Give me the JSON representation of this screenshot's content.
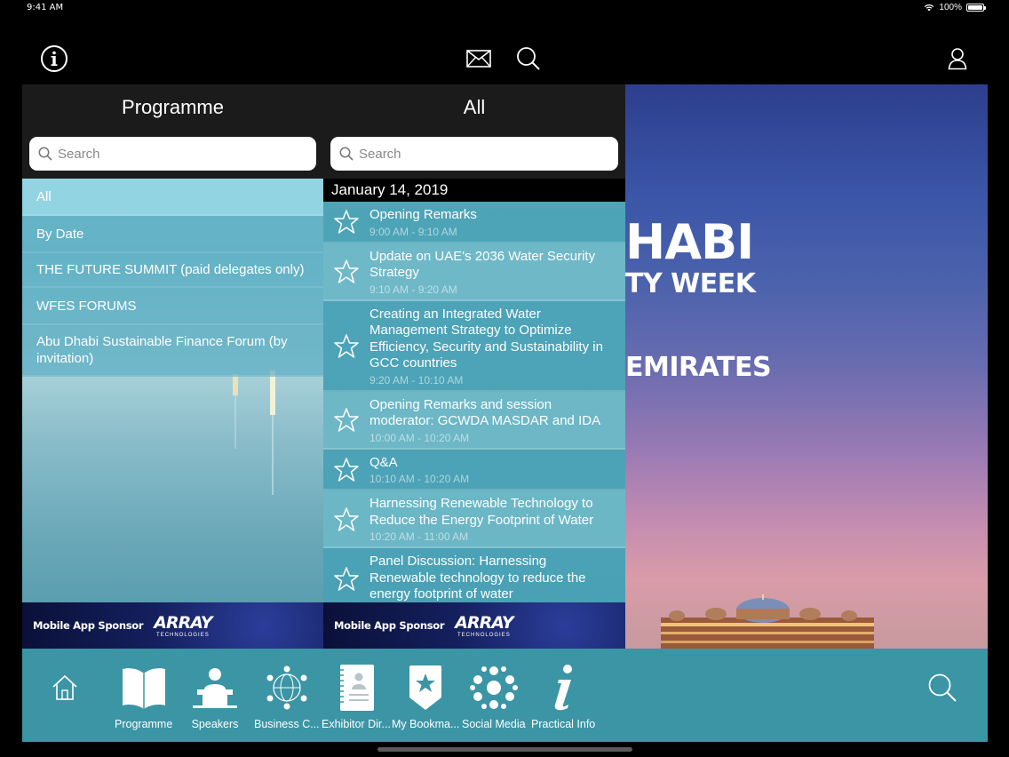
{
  "status_bar": {
    "time": "9:41 AM",
    "battery": "100%"
  },
  "top_bar": {
    "icons": [
      "info-icon",
      "mail-icon",
      "search-icon",
      "user-icon"
    ]
  },
  "programme_panel": {
    "title": "Programme",
    "search_placeholder": "Search",
    "items": [
      {
        "label": "All",
        "active": true
      },
      {
        "label": "By Date"
      },
      {
        "label": "THE FUTURE SUMMIT (paid delegates only)"
      },
      {
        "label": "WFES FORUMS"
      },
      {
        "label": "Abu Dhabi Sustainable Finance Forum (by invitation)"
      }
    ]
  },
  "sessions_panel": {
    "title": "All",
    "search_placeholder": "Search",
    "date": "January 14, 2019",
    "sessions": [
      {
        "title": "Opening Remarks",
        "time": "9:00 AM - 9:10 AM"
      },
      {
        "title": "Update on UAE's 2036 Water Security Strategy",
        "time": "9:10 AM - 9:20 AM"
      },
      {
        "title": "Creating an Integrated Water Management Strategy to Optimize Efficiency, Security and Sustainability in GCC countries",
        "time": "9:20 AM - 10:10 AM"
      },
      {
        "title": "Opening Remarks and session moderator: GCWDA MASDAR and IDA",
        "time": "10:00 AM - 10:20 AM"
      },
      {
        "title": "Q&A",
        "time": "10:10 AM - 10:20 AM"
      },
      {
        "title": "Harnessing Renewable Technology to Reduce the Energy Footprint of Water",
        "time": "10:20 AM - 11:00 AM"
      },
      {
        "title": "Panel Discussion: Harnessing Renewable technology to reduce the energy footprint of water",
        "time": ""
      }
    ]
  },
  "sponsor": {
    "label": "Mobile App Sponsor",
    "logo_name": "ARRAY",
    "logo_sub": "TECHNOLOGIES"
  },
  "hero": {
    "line1": "HABI",
    "line2": "TY WEEK",
    "line3": "EMIRATES"
  },
  "tab_bar": {
    "tabs": [
      {
        "label": "",
        "icon": "home-icon"
      },
      {
        "label": "Programme",
        "icon": "book-icon"
      },
      {
        "label": "Speakers",
        "icon": "speaker-icon"
      },
      {
        "label": "Business C...",
        "icon": "network-icon"
      },
      {
        "label": "Exhibitor Dir...",
        "icon": "directory-icon"
      },
      {
        "label": "My Bookma...",
        "icon": "bookmark-star-icon"
      },
      {
        "label": "Social Media",
        "icon": "social-media-icon"
      },
      {
        "label": "Practical Info",
        "icon": "info-italic-icon"
      },
      {
        "label": "",
        "icon": "search-icon"
      }
    ]
  },
  "colors": {
    "tab_bar": "#3b95a5",
    "header": "#1b1b1c",
    "accent_teal": "#5cafc3"
  }
}
